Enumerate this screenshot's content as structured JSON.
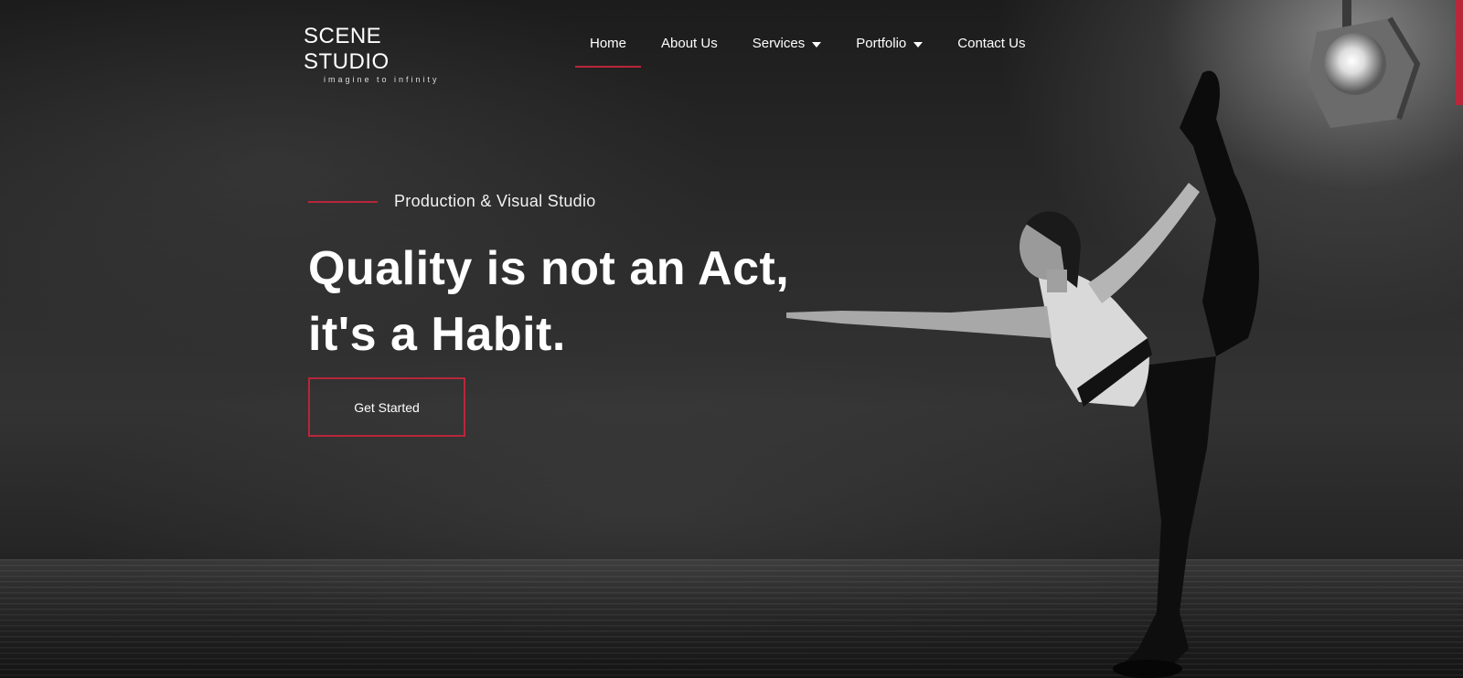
{
  "brand": {
    "name": "SCENE STUDIO",
    "tagline": "imagine to infinity"
  },
  "nav": {
    "items": [
      {
        "label": "Home",
        "active": true,
        "dropdown": false
      },
      {
        "label": "About Us",
        "active": false,
        "dropdown": false
      },
      {
        "label": "Services",
        "active": false,
        "dropdown": true
      },
      {
        "label": "Portfolio",
        "active": false,
        "dropdown": true
      },
      {
        "label": "Contact Us",
        "active": false,
        "dropdown": false
      }
    ]
  },
  "hero": {
    "eyebrow": "Production & Visual Studio",
    "headline_line1": "Quality is not an Act,",
    "headline_line2": "it's a Habit.",
    "cta_label": "Get Started"
  },
  "theme": {
    "accent": "#b8263a",
    "background": "#1f1f1f"
  }
}
